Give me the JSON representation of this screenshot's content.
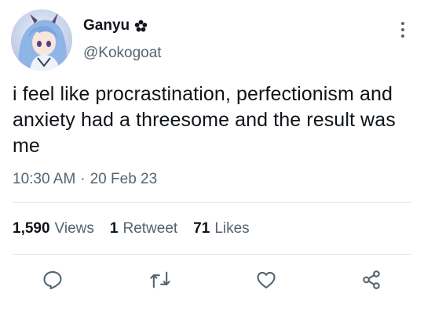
{
  "author": {
    "display_name": "Ganyu",
    "handle": "@Kokogoat",
    "badge_icon": "flower-icon",
    "avatar_icon": "anime-avatar"
  },
  "tweet": {
    "text": "i feel like procrastination, perfectionism and anxiety had a threesome and the result was me",
    "time": "10:30 AM",
    "separator": "·",
    "date": "20 Feb 23"
  },
  "stats": {
    "views_count": "1,590",
    "views_label": "Views",
    "retweets_count": "1",
    "retweets_label": "Retweet",
    "likes_count": "71",
    "likes_label": "Likes"
  },
  "actions": {
    "reply_icon": "reply-icon",
    "retweet_icon": "retweet-icon",
    "like_icon": "heart-icon",
    "share_icon": "share-icon"
  },
  "colors": {
    "text_primary": "#0f1419",
    "text_secondary": "#536471",
    "divider": "#e4e9ed"
  }
}
